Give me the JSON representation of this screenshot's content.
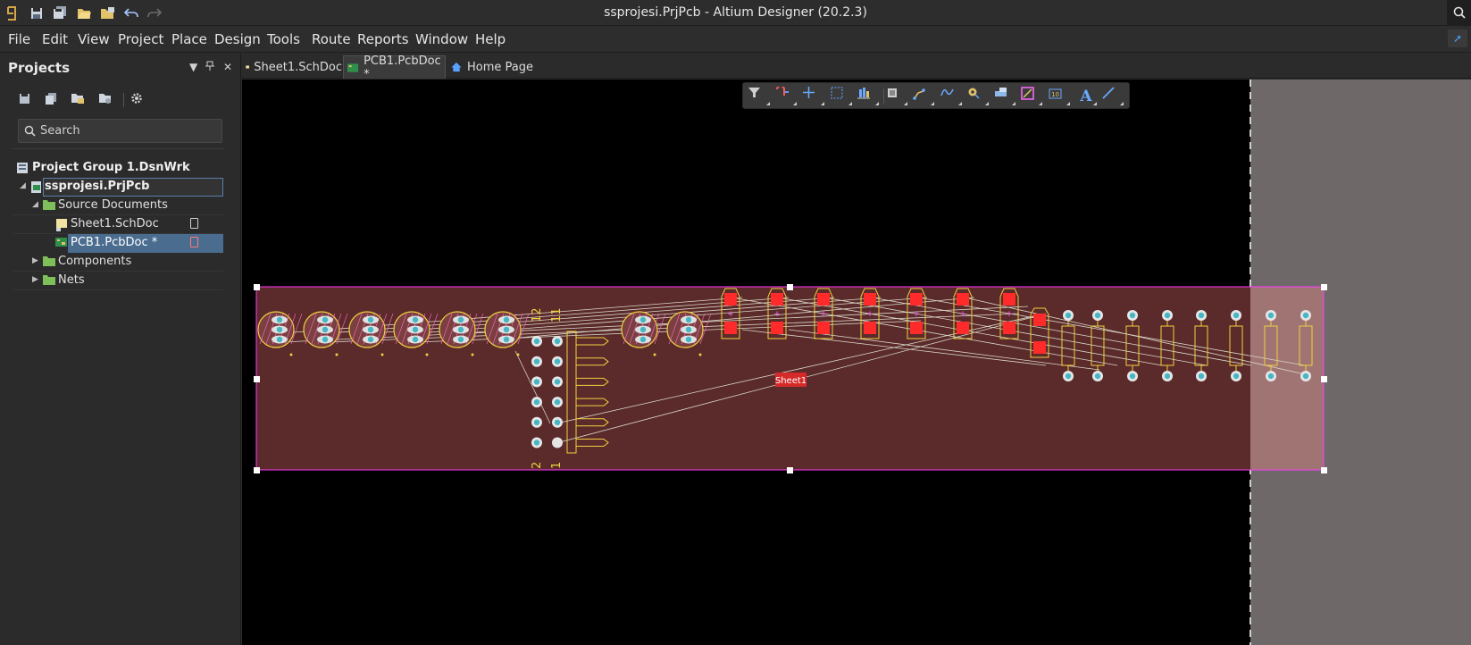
{
  "window": {
    "title": "ssprojesi.PrjPcb - Altium Designer (20.2.3)"
  },
  "quick_access": [
    "app-logo-icon",
    "save-icon",
    "save-all-icon",
    "open-icon",
    "open-project-icon",
    "undo-icon",
    "redo-icon"
  ],
  "menu": [
    {
      "label": "File",
      "key": "F"
    },
    {
      "label": "Edit",
      "key": "E"
    },
    {
      "label": "View",
      "key": "V"
    },
    {
      "label": "Project",
      "key": "C"
    },
    {
      "label": "Place",
      "key": "P"
    },
    {
      "label": "Design",
      "key": "D"
    },
    {
      "label": "Tools",
      "key": "T"
    },
    {
      "label": "Route",
      "key": "U"
    },
    {
      "label": "Reports",
      "key": "R"
    },
    {
      "label": "Window",
      "key": "W"
    },
    {
      "label": "Help",
      "key": "H"
    }
  ],
  "projects_panel": {
    "title": "Projects",
    "search_placeholder": "Search",
    "tree": {
      "group": "Project Group 1.DsnWrk",
      "project": "ssprojesi.PrjPcb",
      "source_folder": "Source Documents",
      "sch_doc": "Sheet1.SchDoc",
      "pcb_doc": "PCB1.PcbDoc *",
      "components": "Components",
      "nets": "Nets"
    }
  },
  "tabs": [
    {
      "label": "Sheet1.SchDoc",
      "active": false
    },
    {
      "label": "PCB1.PcbDoc *",
      "active": true
    },
    {
      "label": "Home Page",
      "active": false
    }
  ],
  "pcb": {
    "room_label": "Sheet1",
    "header_labels": [
      "12",
      "11",
      "2",
      "1"
    ]
  },
  "colors": {
    "accent": "#4aa3ff",
    "board_fill": "#5b2a2a",
    "board_outline": "#ff3bff",
    "copper_yellow": "#f0d040",
    "pad_cyan": "#46b6c4",
    "smd_red": "#ff2a2a",
    "selection": "#4a6c8f"
  }
}
